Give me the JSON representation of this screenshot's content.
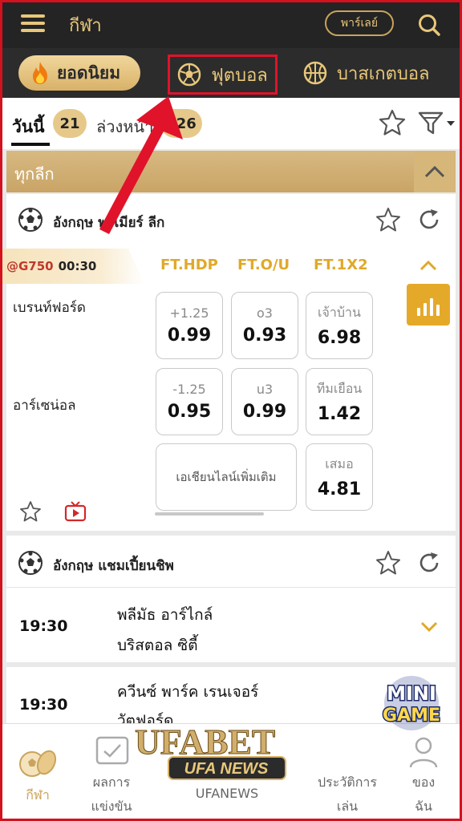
{
  "topbar": {
    "title": "กีฬา",
    "parlay_label": "พาร์เลย์"
  },
  "sport_tabs": {
    "popular": "ยอดนิยม",
    "football": "ฟุตบอล",
    "basketball": "บาสเกตบอล"
  },
  "date_tabs": {
    "today_label": "วันนี้",
    "today_count": "21",
    "future_label": "ล่วงหน้า",
    "future_count": "126"
  },
  "all_leagues_label": "ทุกลีก",
  "league1": {
    "name": "อังกฤษ พรีเมียร์ ลีก",
    "match": {
      "code": "@G750",
      "time": "00:30",
      "col_hdp": "FT.HDP",
      "col_ou": "FT.O/U",
      "col_1x2": "FT.1X2",
      "home": "เบรนท์ฟอร์ด",
      "away": "อาร์เซน่อล",
      "odds": {
        "hdp_home_line": "+1.25",
        "hdp_home_val": "0.99",
        "ou_over_line": "o3",
        "ou_over_val": "0.93",
        "x_home_line": "เจ้าบ้าน",
        "x_home_val": "6.98",
        "hdp_away_line": "-1.25",
        "hdp_away_val": "0.95",
        "ou_under_line": "u3",
        "ou_under_val": "0.99",
        "x_away_line": "ทีมเยือน",
        "x_away_val": "1.42",
        "more_lines": "เอเชียนไลน์เพิ่มเติม",
        "x_draw_line": "เสมอ",
        "x_draw_val": "4.81"
      }
    }
  },
  "league2": {
    "name": "อังกฤษ แชมเปี้ยนชิพ",
    "matches": [
      {
        "time": "19:30",
        "home": "พลีมัธ อาร์ไกล์",
        "away": "บริสตอล ซิตี้"
      },
      {
        "time": "19:30",
        "home": "ควีนซ์ พาร์ค เรนเจอร์",
        "away": "วัตฟอร์ด"
      }
    ]
  },
  "bottom_nav": {
    "sports": "กีฬา",
    "results_line1": "ผลการ",
    "results_line2": "แข่งขัน",
    "news": "UFANEWS",
    "history_line1": "ประวัติการ",
    "history_line2": "เล่น",
    "mine_line1": "ของ",
    "mine_line2": "ฉัน"
  },
  "overlays": {
    "minigame_line1": "MINI",
    "minigame_line2": "GAME",
    "watermark_brand": "UFABET",
    "watermark_news": "UFA NEWS"
  },
  "colors": {
    "gold": "#e8c77a",
    "dark": "#242424",
    "accent_odds": "#e0a928",
    "highlight_red": "#e0132a"
  }
}
